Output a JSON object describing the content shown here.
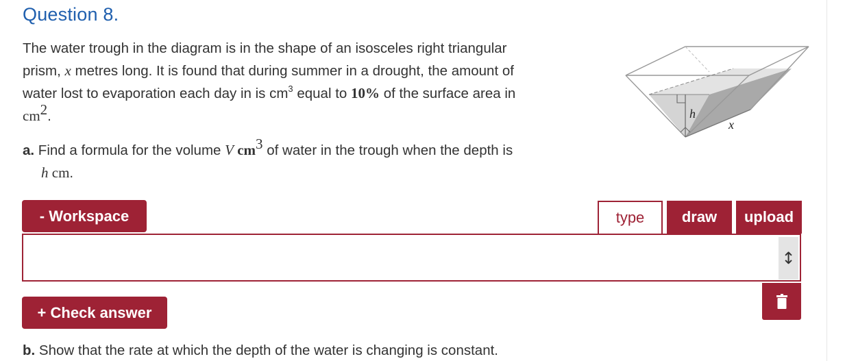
{
  "question": {
    "title": "Question 8.",
    "text": {
      "line1": "The water trough in the diagram is in the shape of an isosceles right triangular",
      "line2_pre": "prism, ",
      "var_x": "x",
      "line2_post": " metres long. It is found that during summer in a drought, the amount of",
      "line3_pre": "water lost to evaporation each day in is cm",
      "line3_exp": "3",
      "line3_mid": " equal to ",
      "line3_pct": "10%",
      "line3_post": " of the surface area in",
      "line4_unit": "cm",
      "line4_exp": "2",
      "line4_post": "."
    }
  },
  "part_a": {
    "label": "a.",
    "text_pre": " Find a formula for the volume ",
    "var_V": "V",
    "unit": " cm",
    "unit_exp": "3",
    "text_post": " of water in the trough when the depth is",
    "var_h": "h",
    "line2_unit": " cm",
    "line2_post": "."
  },
  "part_b": {
    "label": "b.",
    "text": " Show that the rate at which the depth of the water is changing is constant."
  },
  "diagram": {
    "label_h": "h",
    "label_x": "x"
  },
  "workspace": {
    "toggle_label": "- Workspace",
    "tabs": [
      {
        "label": "type",
        "active": true
      },
      {
        "label": "draw",
        "active": false
      },
      {
        "label": "upload",
        "active": false
      }
    ],
    "resize_icon": "vertical-resize-icon",
    "delete_icon": "trash-icon"
  },
  "check_answer_label": "+ Check answer",
  "colors": {
    "accent": "#9e2235",
    "title": "#1f5fae",
    "text": "#333333"
  }
}
